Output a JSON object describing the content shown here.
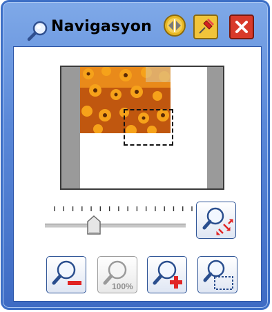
{
  "window": {
    "title": "Navigasyon"
  },
  "titlebar_buttons": [
    "navigate-arrows-icon",
    "pin-icon",
    "close-icon"
  ],
  "preview": {
    "image": "orange-flowers-thumbnail",
    "viewport_frame": "dashed-rectangle"
  },
  "zoom_slider": {
    "tick_count": 16,
    "value_fraction": 0.35
  },
  "buttons": {
    "fit": "zoom-fit-icon",
    "zoom_out": "zoom-out-icon",
    "zoom_100": "100%",
    "zoom_in": "zoom-in-icon",
    "zoom_selection": "zoom-selection-icon"
  },
  "colors": {
    "frame": "#3d6fc6",
    "close": "#d83a2a",
    "pin_bg": "#f1c43a",
    "accent_red": "#e12525"
  }
}
